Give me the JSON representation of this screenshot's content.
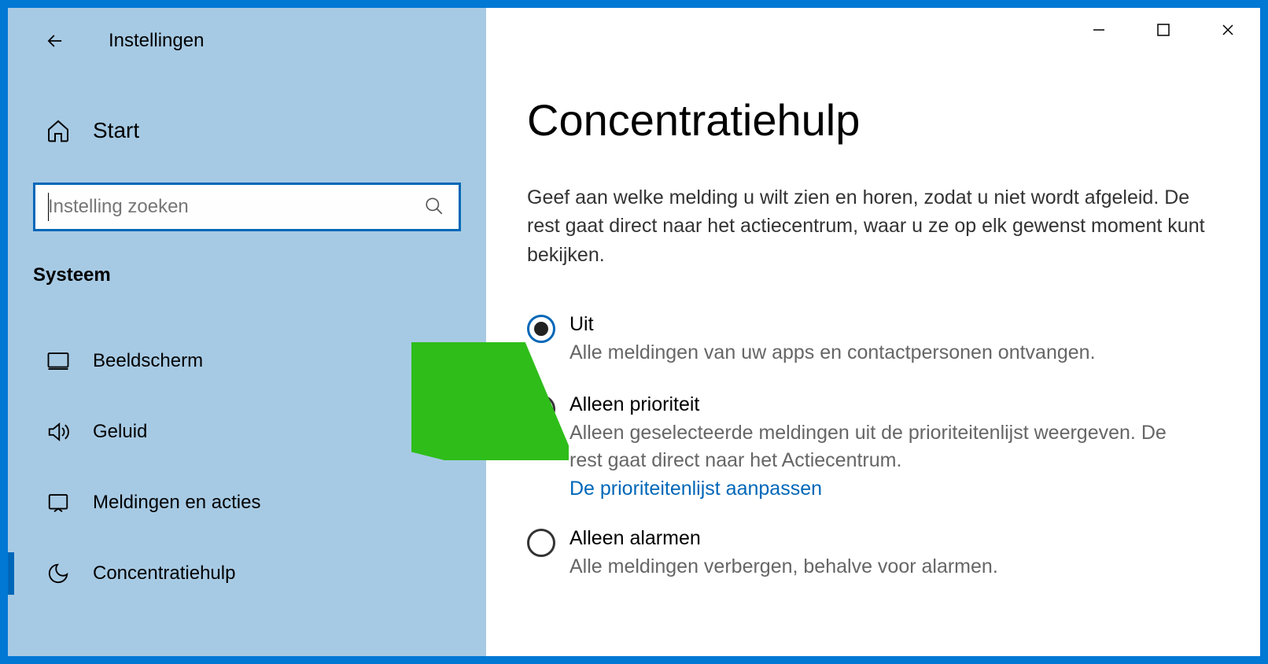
{
  "window": {
    "title": "Instellingen"
  },
  "sidebar": {
    "start_label": "Start",
    "search_placeholder": "Instelling zoeken",
    "category": "Systeem",
    "items": [
      {
        "label": "Beeldscherm",
        "icon": "monitor-icon"
      },
      {
        "label": "Geluid",
        "icon": "sound-icon"
      },
      {
        "label": "Meldingen en acties",
        "icon": "notifications-icon"
      },
      {
        "label": "Concentratiehulp",
        "icon": "moon-icon"
      }
    ],
    "active_index": 3
  },
  "main": {
    "title": "Concentratiehulp",
    "description": "Geef aan welke melding u wilt zien en horen, zodat u niet wordt afgeleid. De rest gaat direct naar het actiecentrum, waar u ze op elk gewenst moment kunt bekijken.",
    "options": [
      {
        "label": "Uit",
        "description": "Alle meldingen van uw apps en contactpersonen ontvangen.",
        "selected": true
      },
      {
        "label": "Alleen prioriteit",
        "description": "Alleen geselecteerde meldingen uit de prioriteitenlijst weergeven. De rest gaat direct naar het Actiecentrum.",
        "link": "De prioriteitenlijst aanpassen",
        "selected": false
      },
      {
        "label": "Alleen alarmen",
        "description": "Alle meldingen verbergen, behalve voor alarmen.",
        "selected": false
      }
    ]
  },
  "colors": {
    "accent": "#0067b8",
    "arrow": "#2fbd1a"
  }
}
